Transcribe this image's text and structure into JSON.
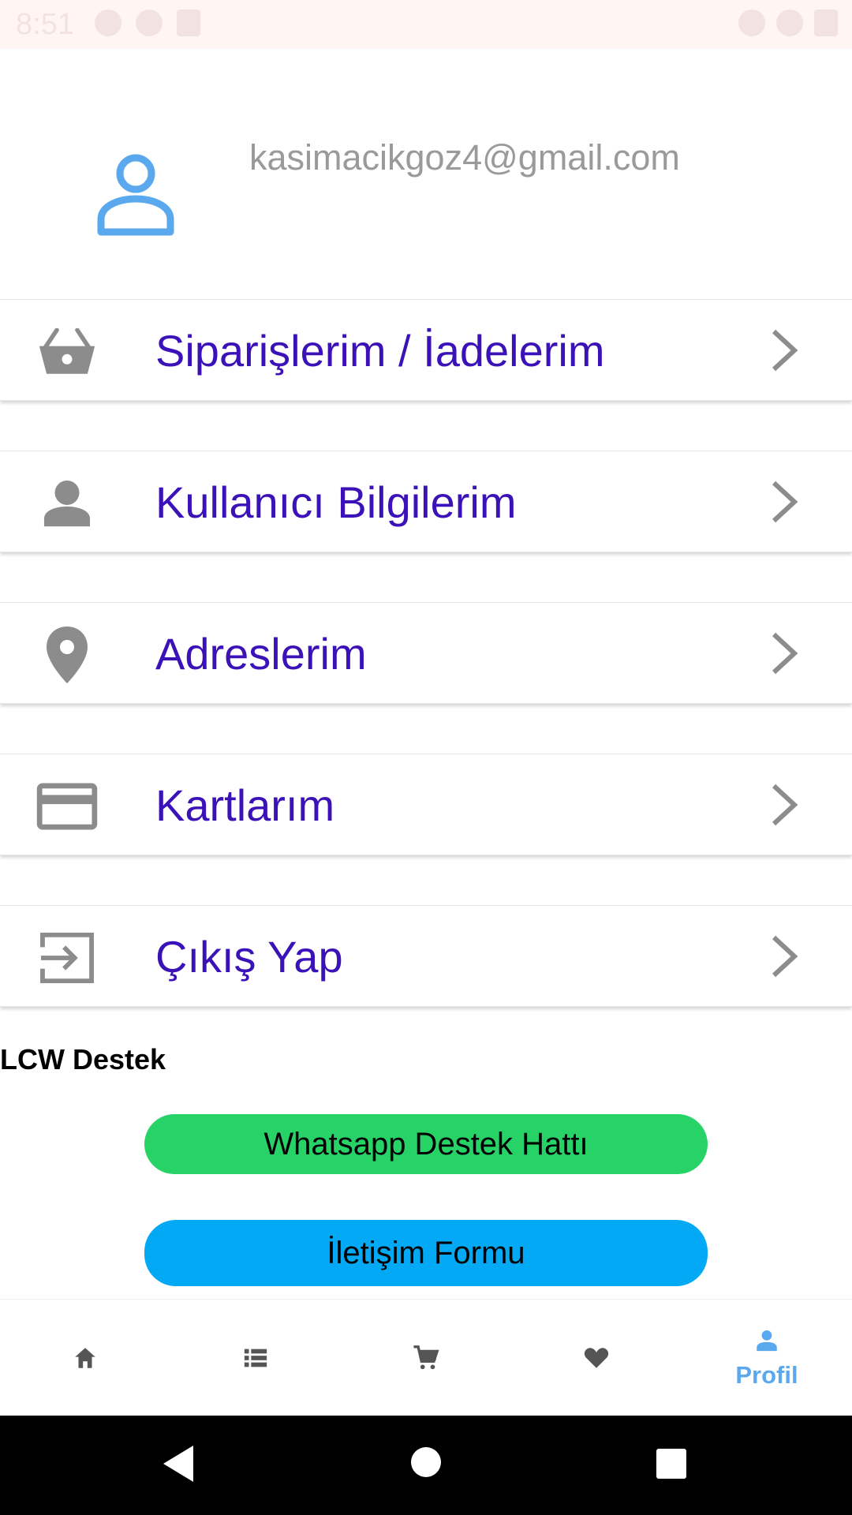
{
  "status_bar": {
    "time": "8:51"
  },
  "profile": {
    "email": "kasimacikgoz4@gmail.com"
  },
  "menu": [
    {
      "label": "Siparişlerim / İadelerim",
      "icon": "shopping-basket-icon"
    },
    {
      "label": "Kullanıcı Bilgilerim",
      "icon": "person-icon"
    },
    {
      "label": "Adreslerim",
      "icon": "location-pin-icon"
    },
    {
      "label": "Kartlarım",
      "icon": "credit-card-icon"
    },
    {
      "label": "Çıkış Yap",
      "icon": "logout-icon"
    }
  ],
  "support": {
    "title": "LCW Destek",
    "whatsapp_label": "Whatsapp Destek Hattı",
    "form_label": "İletişim Formu"
  },
  "bottom_nav": {
    "items": [
      "home-icon",
      "list-icon",
      "cart-icon",
      "heart-icon",
      "person-icon"
    ],
    "active_label": "Profil"
  },
  "colors": {
    "menu_text": "#3a12b8",
    "accent": "#5aa9ef",
    "whatsapp": "#27d366",
    "form": "#03a9f4",
    "icon_gray": "#8c8c8c"
  }
}
